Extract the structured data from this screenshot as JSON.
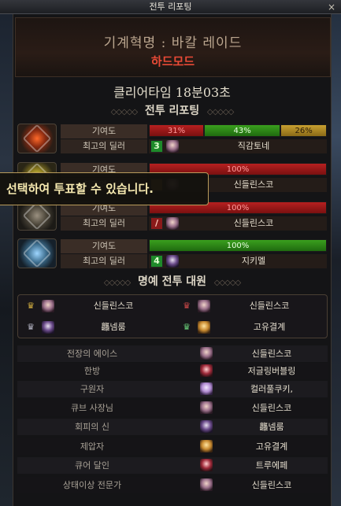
{
  "window": {
    "title": "전투 리포팅",
    "close_glyph": "×"
  },
  "raid": {
    "name": "기계혁명 : 바칼 레이드",
    "mode": "하드모드"
  },
  "clear_time_text": "클리어타임  18분03초",
  "sections": {
    "report": "전투 리포팅",
    "honor": "명예 전투 대원"
  },
  "labels": {
    "contribution": "기여도",
    "best_dealer": "최고의 딜러"
  },
  "tooltip": "선택하여 투표할 수 있습니다.",
  "reports": [
    {
      "bars": [
        {
          "value_text": "31%",
          "fraction": 0.31,
          "color": "red"
        },
        {
          "value_text": "43%",
          "fraction": 0.43,
          "color": "green"
        },
        {
          "value_text": "26%",
          "fraction": 0.26,
          "color": "gold"
        }
      ],
      "dealer_class_glyph": "3",
      "dealer": "직감토네"
    },
    {
      "bars": [
        {
          "value_text": "100%",
          "fraction": 1.0,
          "color": "red"
        }
      ],
      "dealer_class_glyph": "",
      "dealer": "신들린스코"
    },
    {
      "bars": [
        {
          "value_text": "100%",
          "fraction": 1.0,
          "color": "red"
        }
      ],
      "dealer_class_glyph": "/",
      "dealer": "신들린스코"
    },
    {
      "bars": [
        {
          "value_text": "100%",
          "fraction": 1.0,
          "color": "green"
        }
      ],
      "dealer_class_glyph": "4",
      "dealer": "지키멜"
    }
  ],
  "honor": [
    {
      "crown": "gold",
      "name": "신들린스코"
    },
    {
      "crown": "red",
      "name": "신들린스코"
    },
    {
      "crown": "silver",
      "name": "龘넴룸"
    },
    {
      "crown": "green",
      "name": "고유결계"
    }
  ],
  "awards": [
    {
      "title": "전장의 에이스",
      "winner": "신들린스코"
    },
    {
      "title": "한방",
      "winner": "저글링버블링"
    },
    {
      "title": "구원자",
      "winner": "컬러풀쿠키,"
    },
    {
      "title": "큐브 사장님",
      "winner": "신들린스코"
    },
    {
      "title": "회피의 신",
      "winner": "龘넴룸"
    },
    {
      "title": "제압자",
      "winner": "고유결계"
    },
    {
      "title": "큐어 달인",
      "winner": "트루에페"
    },
    {
      "title": "상태이상 전문가",
      "winner": "신들린스코"
    }
  ],
  "colors": {
    "mode_red": "#e84a36",
    "bar_red": "#b62020",
    "bar_green": "#3aa01e",
    "bar_gold": "#c8a030"
  }
}
